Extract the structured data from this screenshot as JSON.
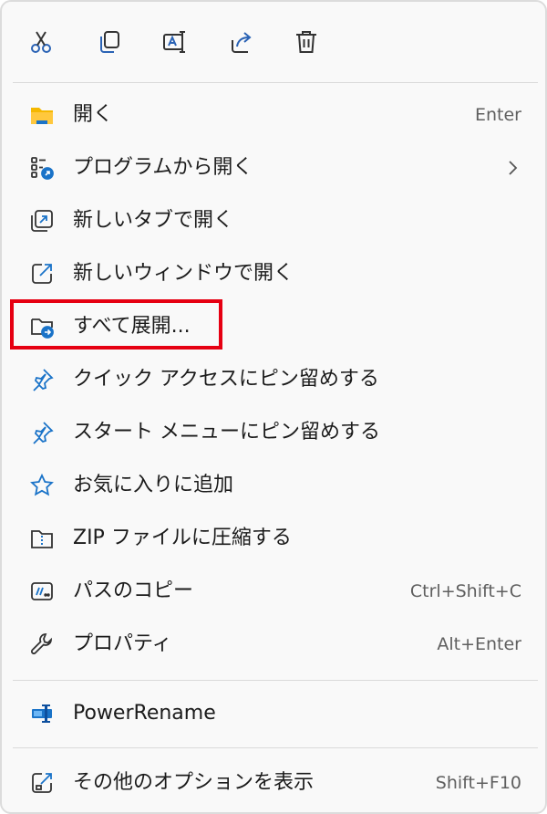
{
  "toolbar": {
    "buttons": [
      {
        "icon": "cut-icon"
      },
      {
        "icon": "copy-icon"
      },
      {
        "icon": "rename-icon"
      },
      {
        "icon": "share-icon"
      },
      {
        "icon": "delete-icon"
      }
    ]
  },
  "menu": {
    "items": [
      {
        "label": "開く",
        "shortcut": "Enter",
        "icon": "folder-icon"
      },
      {
        "label": "プログラムから開く",
        "shortcut": "",
        "icon": "open-with-icon",
        "has_submenu": true
      },
      {
        "label": "新しいタブで開く",
        "shortcut": "",
        "icon": "new-tab-icon"
      },
      {
        "label": "新しいウィンドウで開く",
        "shortcut": "",
        "icon": "new-window-icon"
      },
      {
        "label": "すべて展開...",
        "shortcut": "",
        "icon": "extract-folder-icon",
        "highlighted": true
      },
      {
        "label": "クイック アクセスにピン留めする",
        "shortcut": "",
        "icon": "pin-icon"
      },
      {
        "label": "スタート メニューにピン留めする",
        "shortcut": "",
        "icon": "pin-icon"
      },
      {
        "label": "お気に入りに追加",
        "shortcut": "",
        "icon": "star-icon"
      },
      {
        "label": "ZIP ファイルに圧縮する",
        "shortcut": "",
        "icon": "zip-icon"
      },
      {
        "label": "パスのコピー",
        "shortcut": "Ctrl+Shift+C",
        "icon": "copy-path-icon"
      },
      {
        "label": "プロパティ",
        "shortcut": "Alt+Enter",
        "icon": "wrench-icon"
      }
    ],
    "power_rename": {
      "label": "PowerRename",
      "icon": "power-rename-icon"
    },
    "more_options": {
      "label": "その他のオプションを表示",
      "shortcut": "Shift+F10",
      "icon": "more-options-icon"
    }
  },
  "colors": {
    "highlight_border": "#e60012",
    "accent_blue": "#1a73c8",
    "folder_yellow": "#f5b800"
  }
}
